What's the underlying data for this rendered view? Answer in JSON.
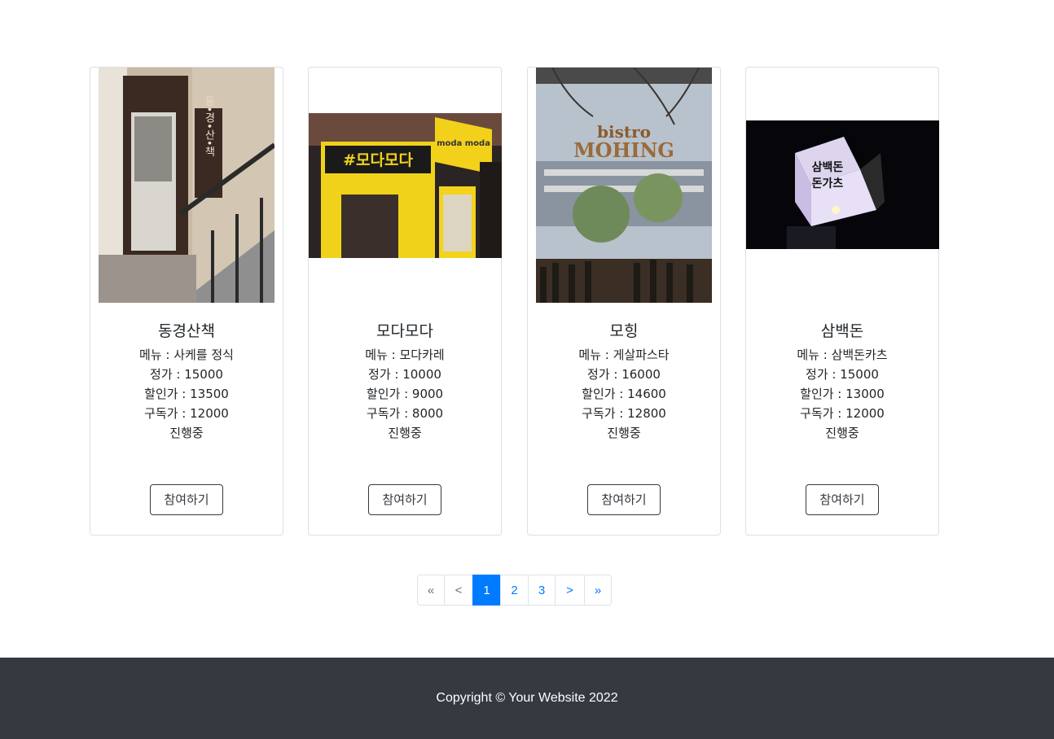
{
  "cards": [
    {
      "title": "동경산책",
      "menu": "메뉴 : 사케를 정식",
      "price": "정가 : 15000",
      "sale": "할인가 : 13500",
      "sub": "구독가 : 12000",
      "status": "진행중",
      "button": "참여하기"
    },
    {
      "title": "모다모다",
      "menu": "메뉴 : 모다카레",
      "price": "정가 : 10000",
      "sale": "할인가 : 9000",
      "sub": "구독가 : 8000",
      "status": "진행중",
      "button": "참여하기"
    },
    {
      "title": "모힝",
      "menu": "메뉴 : 게살파스타",
      "price": "정가 : 16000",
      "sale": "할인가 : 14600",
      "sub": "구독가 : 12800",
      "status": "진행중",
      "button": "참여하기"
    },
    {
      "title": "삼백돈",
      "menu": "메뉴 : 삼백돈카츠",
      "price": "정가 : 15000",
      "sale": "할인가 : 13000",
      "sub": "구독가 : 12000",
      "status": "진행중",
      "button": "참여하기"
    }
  ],
  "images": {
    "card1_signage": "동•경•산•책",
    "card2_signage": "#모다모다",
    "card2_box": "moda moda",
    "card3_sign_top": "bistro",
    "card3_sign_bottom": "MOHING",
    "card4_sign_top": "삼백돈",
    "card4_sign_bottom": "돈가츠"
  },
  "pagination": {
    "first": "«",
    "prev": "<",
    "pages": [
      "1",
      "2",
      "3"
    ],
    "next": ">",
    "last": "»",
    "active": "1"
  },
  "footer": {
    "copyright": "Copyright © Your Website 2022"
  },
  "colors": {
    "primary": "#007bff",
    "footer_bg": "#343a40",
    "button_border": "#343a40"
  }
}
